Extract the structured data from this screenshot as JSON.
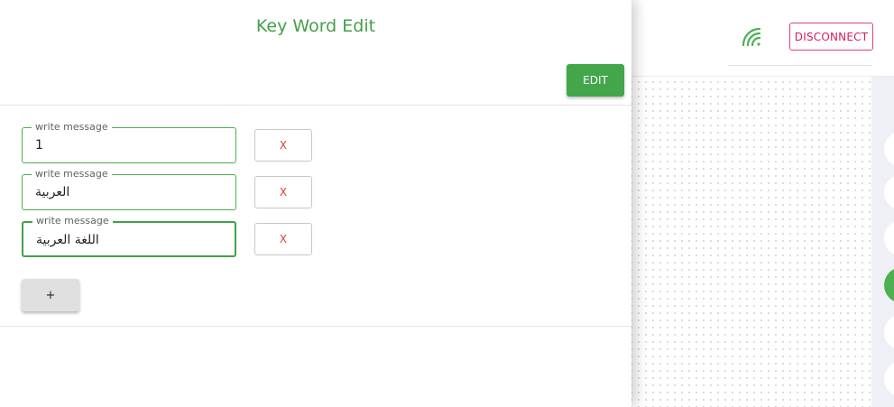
{
  "drawer": {
    "title": "Key Word Edit",
    "edit_label": "EDIT",
    "messages": [
      {
        "label": "write message",
        "value": "1"
      },
      {
        "label": "write message",
        "value": "العربية"
      },
      {
        "label": "write message",
        "value": "اللغة العربية"
      }
    ],
    "remove_label": "X",
    "add_label": "+"
  },
  "header": {
    "disconnect_label": "DISCONNECT",
    "signal_icon": "wifi-signal-icon"
  },
  "colors": {
    "accent": "#43a047",
    "danger": "#d81b60"
  }
}
